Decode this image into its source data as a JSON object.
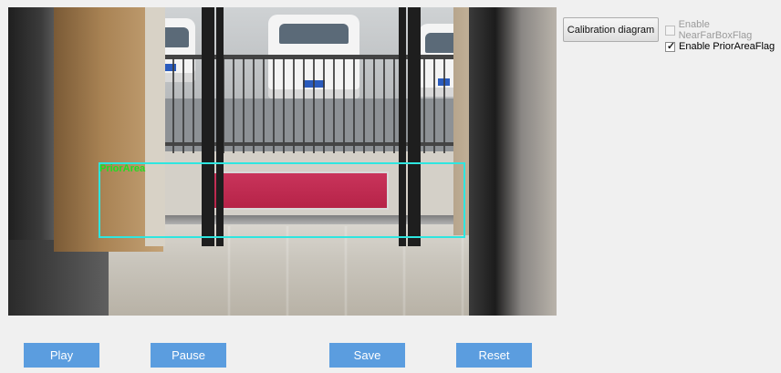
{
  "video": {
    "overlay_label": "PriorArea",
    "overlay_box_color": "#2ee6e0",
    "overlay_label_color": "#22dd22"
  },
  "panel": {
    "calibration_button": "Calibration diagram",
    "checkboxes": [
      {
        "label": "Enable NearFarBoxFlag",
        "checked": false,
        "enabled": false
      },
      {
        "label": "Enable PriorAreaFlag",
        "checked": true,
        "enabled": true
      }
    ]
  },
  "controls": {
    "play": "Play",
    "pause": "Pause",
    "save": "Save",
    "reset": "Reset",
    "button_color": "#5b9ddf"
  }
}
